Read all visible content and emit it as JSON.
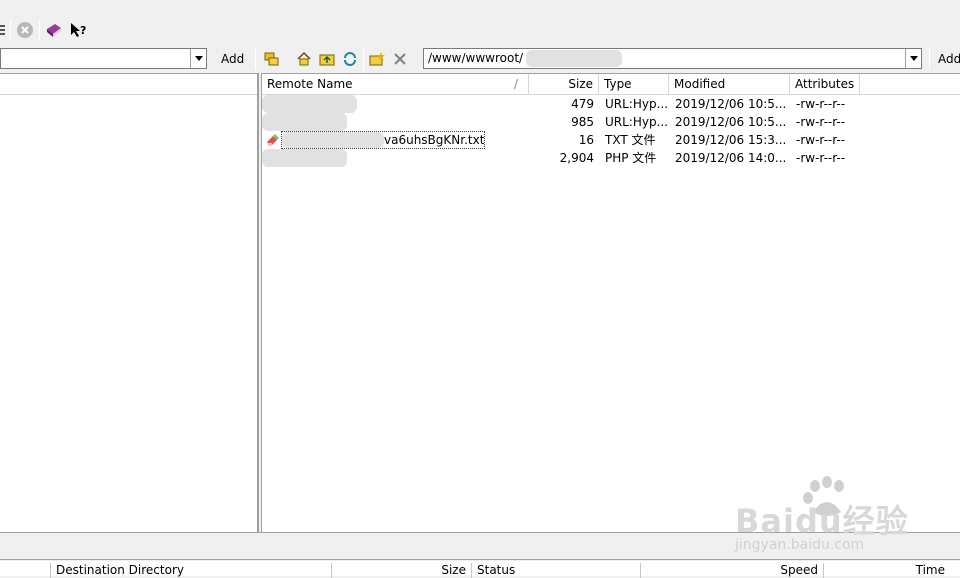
{
  "toolbar": {
    "buttons": [
      "list-icon",
      "stop-icon",
      "book-icon",
      "help-cursor-icon"
    ]
  },
  "address": {
    "local_path": "",
    "add_label": "Add",
    "remote_path": "/www/wwwroot/",
    "remote_add_label": "Add",
    "remote_toolbar_icons": [
      "folders-icon",
      "home-icon",
      "up-folder-icon",
      "refresh-icon",
      "new-folder-icon",
      "delete-icon"
    ]
  },
  "remote": {
    "columns": {
      "name": "Remote Name",
      "sort_indicator": "/",
      "size": "Size",
      "type": "Type",
      "modified": "Modified",
      "attributes": "Attributes"
    },
    "files": [
      {
        "name": "",
        "size": "479",
        "type": "URL:Hyp...",
        "modified": "2019/12/06 10:5...",
        "attributes": "-rw-r--r--"
      },
      {
        "name": "",
        "size": "985",
        "type": "URL:Hyp...",
        "modified": "2019/12/06 10:5...",
        "attributes": "-rw-r--r--"
      },
      {
        "name": "va6uhsBgKNr.txt",
        "size": "16",
        "type": "TXT 文件",
        "modified": "2019/12/06 15:3...",
        "attributes": "-rw-r--r--"
      },
      {
        "name": "",
        "size": "2,904",
        "type": "PHP 文件",
        "modified": "2019/12/06 14:0...",
        "attributes": "-rw-r--r--"
      }
    ]
  },
  "queue": {
    "columns": {
      "destination": "Destination Directory",
      "size": "Size",
      "status": "Status",
      "speed": "Speed",
      "time": "Time"
    }
  },
  "watermark": {
    "brand": "Baidu经验",
    "url": "jingyan.baidu.com"
  }
}
